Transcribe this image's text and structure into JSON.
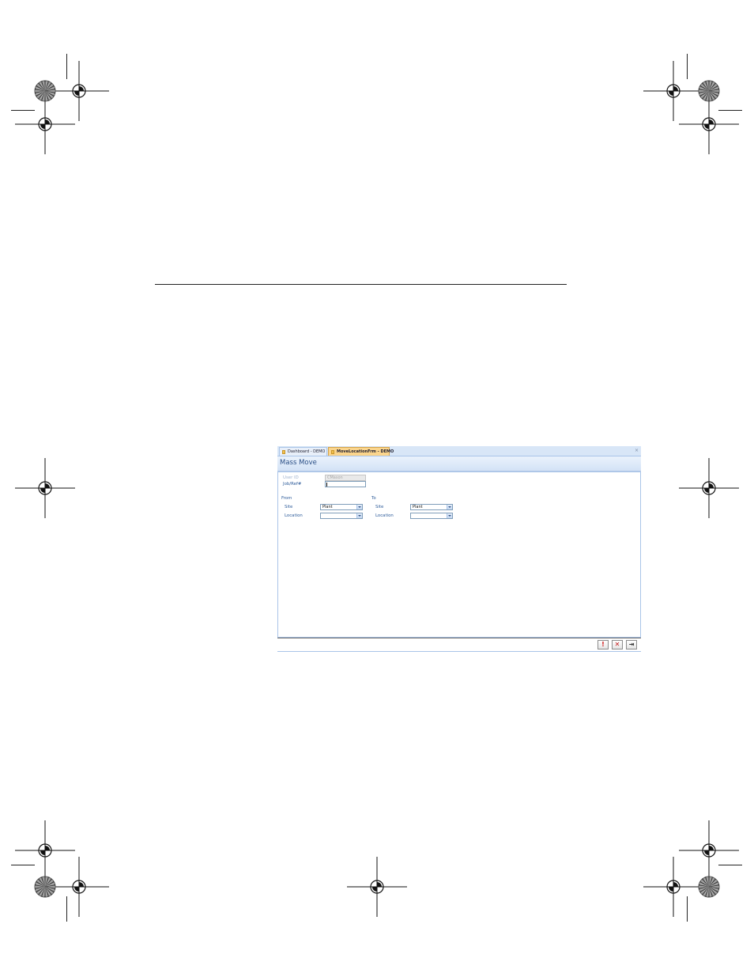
{
  "tabs": [
    {
      "label": "Dashboard - DEMO",
      "active": false
    },
    {
      "label": "MoveLocationFrm - DEMO",
      "active": true
    }
  ],
  "close_glyph": "×",
  "form": {
    "title": "Mass Move",
    "user_id_label": "User ID",
    "user_id_value": "CMason",
    "jobref_label": "Job/Ref#",
    "jobref_value": "",
    "from": {
      "heading": "From",
      "site_label": "Site",
      "site_value": "Plant",
      "location_label": "Location",
      "location_value": ""
    },
    "to": {
      "heading": "To",
      "site_label": "Site",
      "site_value": "Plant",
      "location_label": "Location",
      "location_value": ""
    }
  },
  "buttons": {
    "execute_glyph": "!",
    "cancel_glyph": "✕",
    "exit_glyph": "⇥"
  },
  "icons": [
    "form-tab-icon",
    "close-icon",
    "chevron-down-icon",
    "registration-mark-icon"
  ],
  "colors": {
    "accent": "#2a4f86",
    "label": "#2d5b9a",
    "active_tab": "#fbd58c",
    "frame": "#a9c4e8"
  }
}
